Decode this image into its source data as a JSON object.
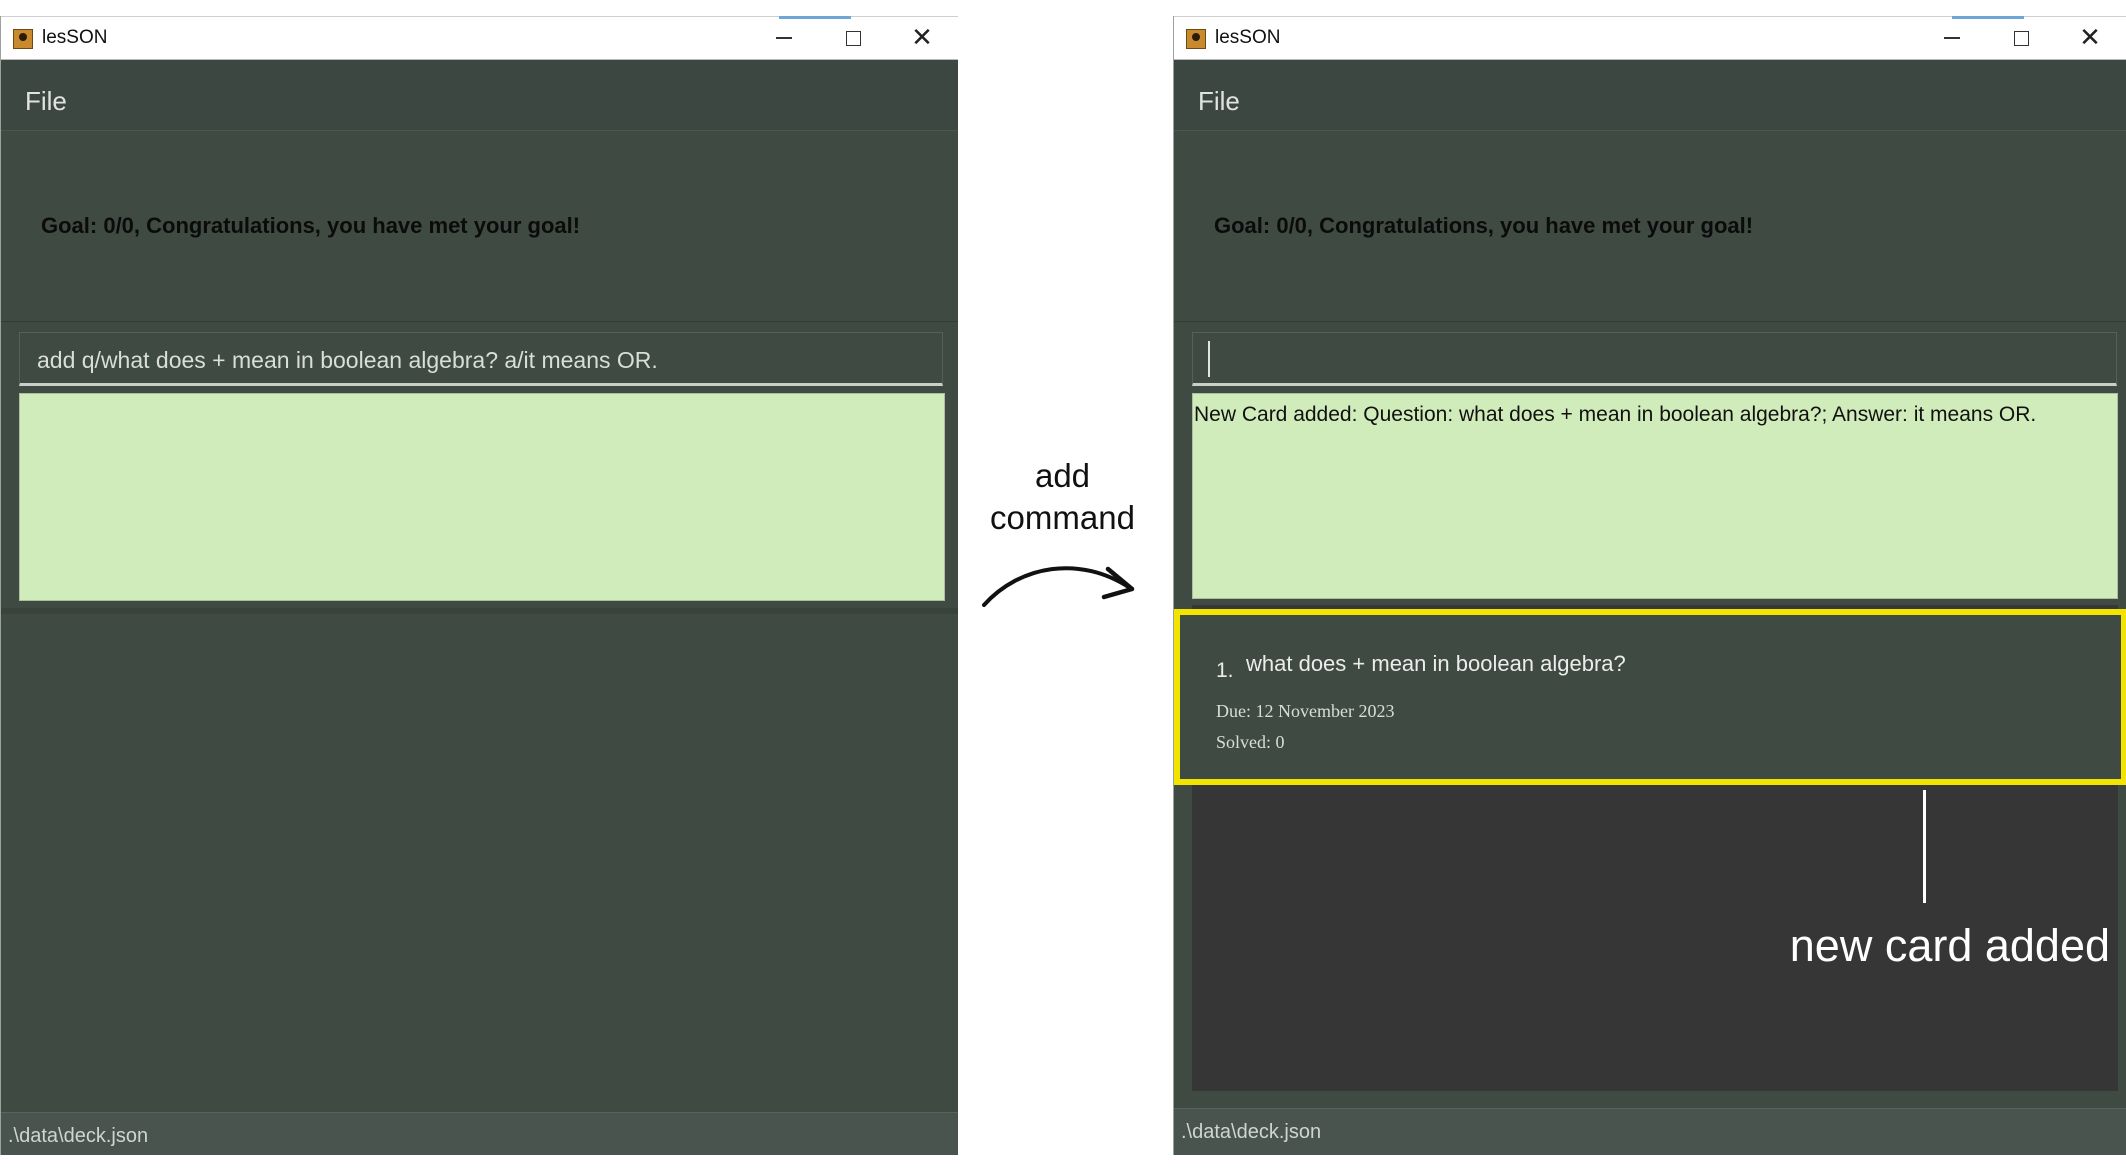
{
  "windows": [
    {
      "title": "lesSON",
      "menu": {
        "file_label": "File"
      },
      "goal_text": "Goal: 0/0, Congratulations, you have met your goal!",
      "command_input": {
        "value": "add q/what does + mean in boolean algebra? a/it means OR."
      },
      "result_text": "",
      "status_path": ".\\data\\deck.json"
    },
    {
      "title": "lesSON",
      "menu": {
        "file_label": "File"
      },
      "goal_text": "Goal: 0/0, Congratulations, you have met your goal!",
      "command_input": {
        "value": ""
      },
      "result_text": "New Card added: Question: what does + mean in boolean algebra?; Answer: it means OR.",
      "cards": [
        {
          "index": "1.",
          "question": "what does + mean in boolean algebra?",
          "due": "Due: 12 November 2023",
          "solved": "Solved: 0"
        }
      ],
      "status_path": ".\\data\\deck.json"
    }
  ],
  "annotations": {
    "arrow_label": "add\ncommand",
    "callout": "new card added",
    "highlight_color": "#f2e400"
  },
  "colors": {
    "window_bg": "#3f4a43",
    "result_bg": "#d1ecbb",
    "card_list_bg": "#363636"
  }
}
